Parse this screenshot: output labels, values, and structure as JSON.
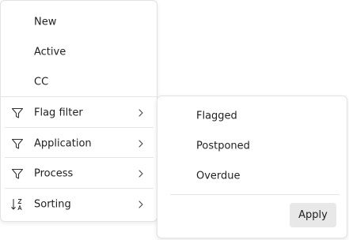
{
  "menu": {
    "items": [
      {
        "label": "New",
        "icon": null,
        "has_submenu": false
      },
      {
        "label": "Active",
        "icon": null,
        "has_submenu": false
      },
      {
        "label": "CC",
        "icon": null,
        "has_submenu": false
      },
      {
        "label": "Flag filter",
        "icon": "filter-icon",
        "has_submenu": true
      },
      {
        "label": "Application",
        "icon": "filter-icon",
        "has_submenu": true
      },
      {
        "label": "Process",
        "icon": "filter-icon",
        "has_submenu": true
      },
      {
        "label": "Sorting",
        "icon": "sort-icon",
        "has_submenu": true
      }
    ]
  },
  "submenu": {
    "parent": "Flag filter",
    "items": [
      {
        "label": "Flagged"
      },
      {
        "label": "Postponed"
      },
      {
        "label": "Overdue"
      }
    ],
    "apply_label": "Apply"
  },
  "colors": {
    "text": "#1f1f1f",
    "border": "#e3e3e3",
    "button_bg": "#e8e8e8"
  }
}
